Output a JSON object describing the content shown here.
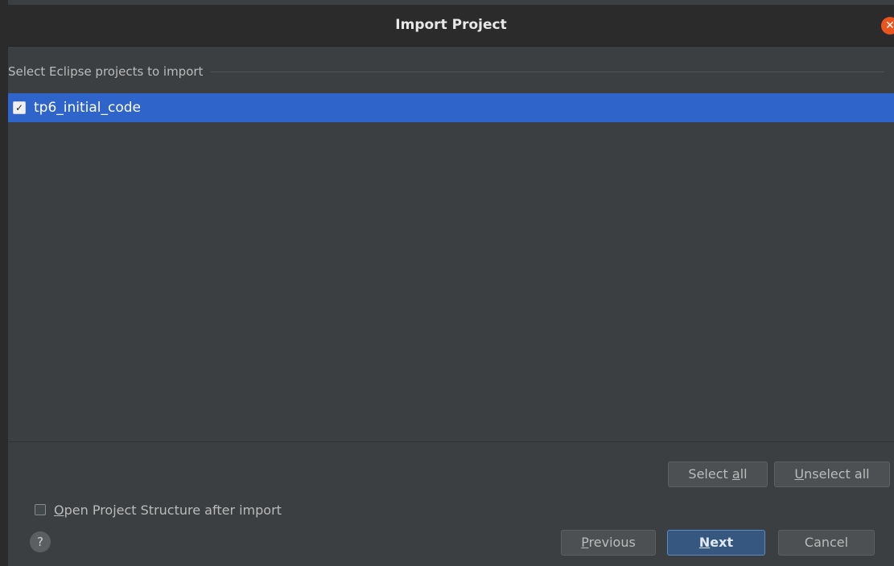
{
  "window": {
    "title": "Import Project",
    "close_icon": "close-icon"
  },
  "section": {
    "label": "Select Eclipse projects to import"
  },
  "projects": [
    {
      "name": "tp6_initial_code",
      "checked": true,
      "selected": true
    }
  ],
  "buttons": {
    "select_all": {
      "pre": "Select ",
      "mn": "a",
      "post": "ll"
    },
    "unselect_all": {
      "pre": "",
      "mn": "U",
      "post": "nselect all"
    },
    "previous": {
      "pre": "",
      "mn": "P",
      "post": "revious"
    },
    "next": {
      "pre": "",
      "mn": "N",
      "post": "ext"
    },
    "cancel": "Cancel"
  },
  "options": {
    "open_structure": {
      "pre": "",
      "mn": "O",
      "post": "pen Project Structure after import",
      "checked": false
    }
  },
  "help": {
    "glyph": "?"
  },
  "colors": {
    "selection": "#2f65ca",
    "close": "#e9541f",
    "primary_button": "#365880",
    "background": "#3c3f41"
  }
}
